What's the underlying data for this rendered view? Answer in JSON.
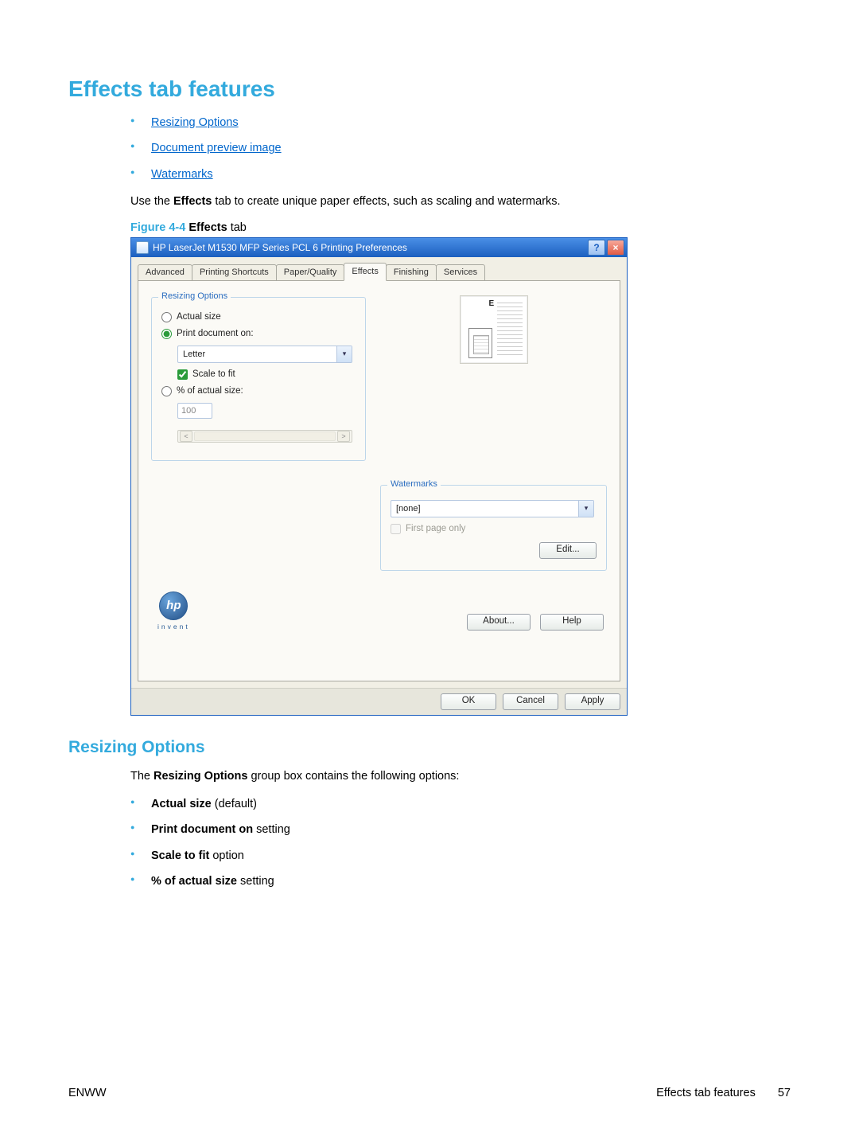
{
  "heading": "Effects tab features",
  "toc": {
    "items": [
      "Resizing Options",
      "Document preview image",
      "Watermarks"
    ]
  },
  "intro": {
    "pre": "Use the ",
    "bold": "Effects",
    "post": " tab to create unique paper effects, such as scaling and watermarks."
  },
  "figure": {
    "label": "Figure 4-4",
    "title_pre": "  Effects ",
    "title_rest": "tab"
  },
  "dialog": {
    "title": "HP LaserJet M1530 MFP Series PCL 6 Printing Preferences",
    "help_btn": "?",
    "close_btn": "×",
    "tabs": [
      "Advanced",
      "Printing Shortcuts",
      "Paper/Quality",
      "Effects",
      "Finishing",
      "Services"
    ],
    "active_tab_index": 3,
    "resizing": {
      "legend": "Resizing Options",
      "actual_size": "Actual size",
      "print_doc_on": "Print document on:",
      "paper_value": "Letter",
      "scale_to_fit": "Scale to fit",
      "percent_label": "% of actual size:",
      "percent_value": "100",
      "slider_left": "<",
      "slider_right": ">"
    },
    "preview": {
      "marker": "E"
    },
    "watermarks": {
      "legend": "Watermarks",
      "value": "[none]",
      "first_page_only": "First page only",
      "edit": "Edit..."
    },
    "hp": {
      "logo_text": "hp",
      "invent": "invent"
    },
    "about": "About...",
    "help": "Help",
    "ok": "OK",
    "cancel": "Cancel",
    "apply": "Apply"
  },
  "section2": {
    "heading": "Resizing Options",
    "intro_pre": "The ",
    "intro_bold": "Resizing Options",
    "intro_post": " group box contains the following options:",
    "items": [
      {
        "bold": "Actual size",
        "rest": " (default)"
      },
      {
        "bold": "Print document on",
        "rest": " setting"
      },
      {
        "bold": "Scale to fit",
        "rest": " option"
      },
      {
        "bold": "% of actual size",
        "rest": " setting"
      }
    ]
  },
  "footer": {
    "left": "ENWW",
    "right": "Effects tab features",
    "page": "57"
  }
}
